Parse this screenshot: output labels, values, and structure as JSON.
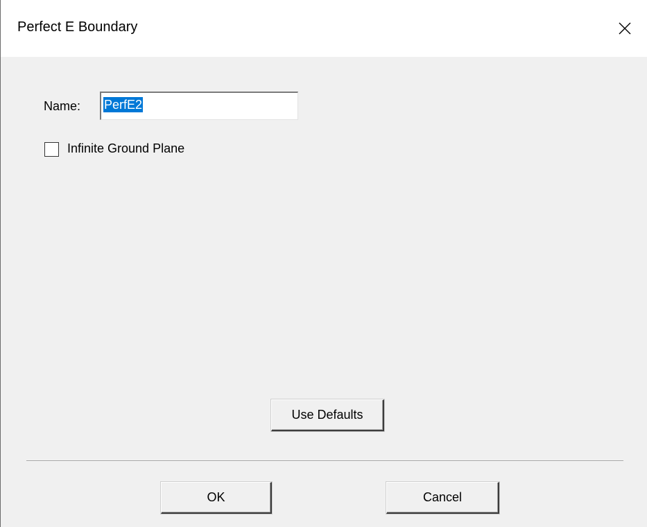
{
  "window": {
    "title": "Perfect E Boundary",
    "close_icon": "close-icon"
  },
  "form": {
    "name_label": "Name:",
    "name_value": "PerfE2",
    "infinite_ground_plane_label": "Infinite Ground Plane",
    "infinite_ground_plane_checked": false
  },
  "buttons": {
    "use_defaults": "Use Defaults",
    "ok": "OK",
    "cancel": "Cancel"
  },
  "colors": {
    "selection": "#0078d7",
    "dialog_bg": "#f0f0f0",
    "titlebar_bg": "#ffffff"
  }
}
